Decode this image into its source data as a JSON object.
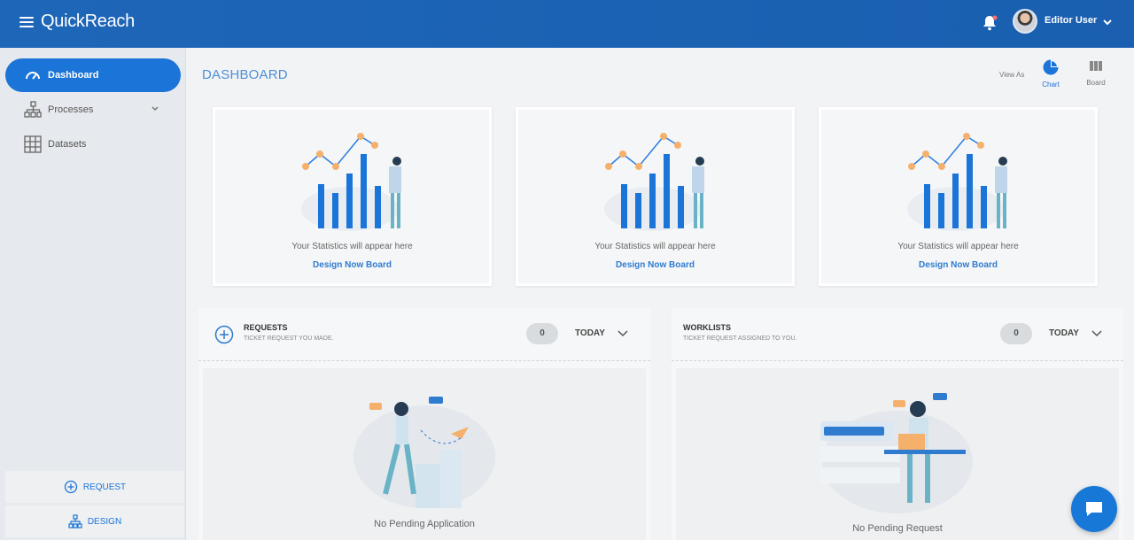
{
  "header": {
    "app_title": "QuickReach",
    "username": "Editor User"
  },
  "sidebar": {
    "items": [
      {
        "label": "Dashboard",
        "active": true
      },
      {
        "label": "Processes"
      },
      {
        "label": "Datasets"
      }
    ],
    "bottom": {
      "request_label": "REQUEST",
      "design_label": "DESIGN"
    }
  },
  "main": {
    "title": "DASHBOARD",
    "view_as": {
      "label": "View As",
      "chart": "Chart",
      "board": "Board"
    },
    "stat_cards": [
      {
        "text": "Your Statistics will appear here",
        "link": "Design Now Board"
      },
      {
        "text": "Your Statistics will appear here",
        "link": "Design Now Board"
      },
      {
        "text": "Your Statistics will appear here",
        "link": "Design Now Board"
      }
    ],
    "requests": {
      "title": "REQUESTS",
      "subtitle": "TICKET REQUEST YOU MADE.",
      "count": "0",
      "period": "TODAY",
      "empty": "No Pending Application"
    },
    "worklists": {
      "title": "WORKLISTS",
      "subtitle": "TICKET REQUEST ASSIGNED TO YOU.",
      "count": "0",
      "period": "TODAY",
      "empty": "No Pending Request"
    }
  },
  "colors": {
    "primary": "#1b74d8",
    "header": "#1e66b8",
    "accent_orange": "#f5b06c"
  },
  "icons": [
    "menu-icon",
    "bell-icon",
    "chevron-down-icon",
    "dashboard-icon",
    "processes-icon",
    "datasets-icon",
    "plus-circle-icon",
    "design-icon",
    "chart-icon",
    "board-icon",
    "chat-icon"
  ]
}
